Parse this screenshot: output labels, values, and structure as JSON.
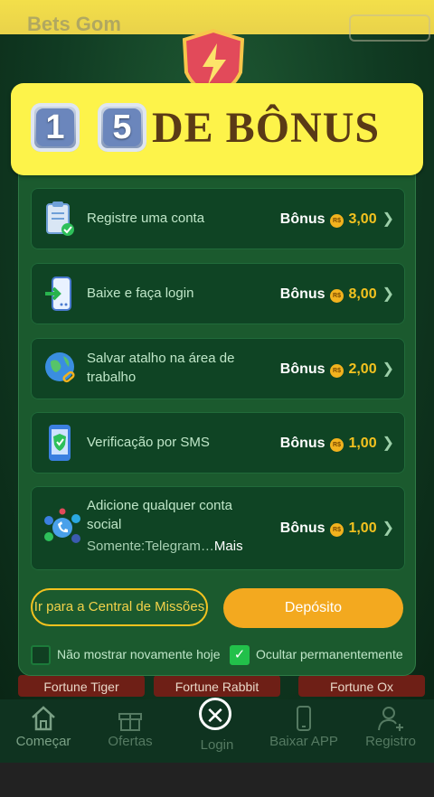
{
  "background": {
    "site_logo": "Bets Gom",
    "strips": [
      "Fortune Tiger",
      "Fortune Rabbit",
      "Fortune Ox"
    ]
  },
  "banner": {
    "digits": [
      "1",
      "5"
    ],
    "title": "DE BÔNUS"
  },
  "tasks": [
    {
      "label": "Registre uma conta",
      "reward_label": "Bônus",
      "amount": "3,00",
      "icon": "clipboard-check-icon"
    },
    {
      "label": "Baixe e faça login",
      "reward_label": "Bônus",
      "amount": "8,00",
      "icon": "phone-download-icon"
    },
    {
      "label": "Salvar atalho na área de trabalho",
      "reward_label": "Bônus",
      "amount": "2,00",
      "icon": "globe-link-icon"
    },
    {
      "label": "Verificação por SMS",
      "reward_label": "Bônus",
      "amount": "1,00",
      "icon": "phone-shield-icon"
    },
    {
      "label": "Adicione qualquer conta social",
      "sub": "Somente:Telegram…",
      "more": "Mais",
      "reward_label": "Bônus",
      "amount": "1,00",
      "icon": "social-network-icon"
    }
  ],
  "currency_symbol": "R$",
  "buttons": {
    "mission_center": "Ir para a Central de Missões",
    "deposit": "Depósito"
  },
  "checkboxes": [
    {
      "label": "Não mostrar novamente hoje",
      "checked": false
    },
    {
      "label": "Ocultar permanentemente",
      "checked": true
    }
  ],
  "nav": [
    {
      "label": "Começar",
      "icon": "home-icon"
    },
    {
      "label": "Ofertas",
      "icon": "gift-icon"
    },
    {
      "label": "Login",
      "icon": "login-icon"
    },
    {
      "label": "Baixar APP",
      "icon": "phone-icon"
    },
    {
      "label": "Registro",
      "icon": "user-add-icon"
    }
  ],
  "colors": {
    "banner_bg": "#fdf34a",
    "modal_bg": "#1b5a2e",
    "accent_gold": "#f3c21f",
    "deposit_btn": "#f3a91f"
  }
}
